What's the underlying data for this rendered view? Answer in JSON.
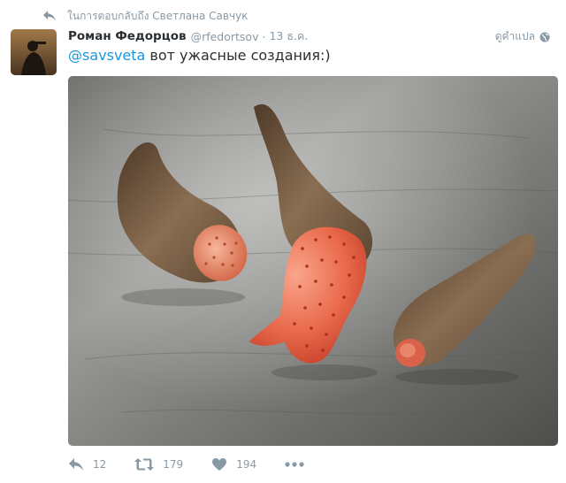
{
  "context": {
    "text": "ในการตอบกลับถึง Светлана Савчук",
    "icon": "reply-arrow-icon"
  },
  "tweet": {
    "name": "Роман Федорцов",
    "handle": "@rfedortsov",
    "separator": "·",
    "date": "13 ธ.ค.",
    "translate": "ดูคำแปล",
    "mention": "@savsveta",
    "body": " вот ужасные создания:)"
  },
  "actions": {
    "reply_count": "12",
    "retweet_count": "179",
    "like_count": "194"
  },
  "colors": {
    "link": "#1b95e0",
    "muted": "#8899a6",
    "text": "#292f33"
  }
}
